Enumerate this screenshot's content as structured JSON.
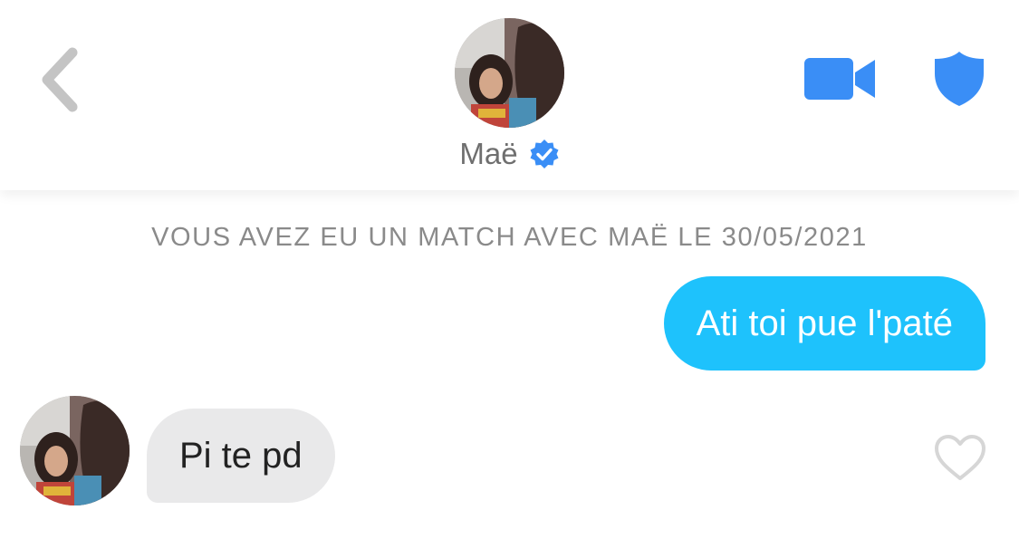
{
  "header": {
    "back_icon": "chevron-left-icon",
    "profile_name": "Maë",
    "verified_icon": "verified-check-icon",
    "video_icon": "video-camera-icon",
    "safety_icon": "shield-icon",
    "accent_color": "#3a8ef6"
  },
  "conversation": {
    "match_notice": "VOUS AVEZ EU UN MATCH AVEC MAË LE 30/05/2021",
    "messages": [
      {
        "direction": "sent",
        "text": "Ati toi pue l'paté",
        "bubble_color": "#1ec2fc"
      },
      {
        "direction": "received",
        "text": "Pi te pd",
        "bubble_color": "#e9e9ea",
        "like_icon": "heart-outline-icon"
      }
    ]
  }
}
